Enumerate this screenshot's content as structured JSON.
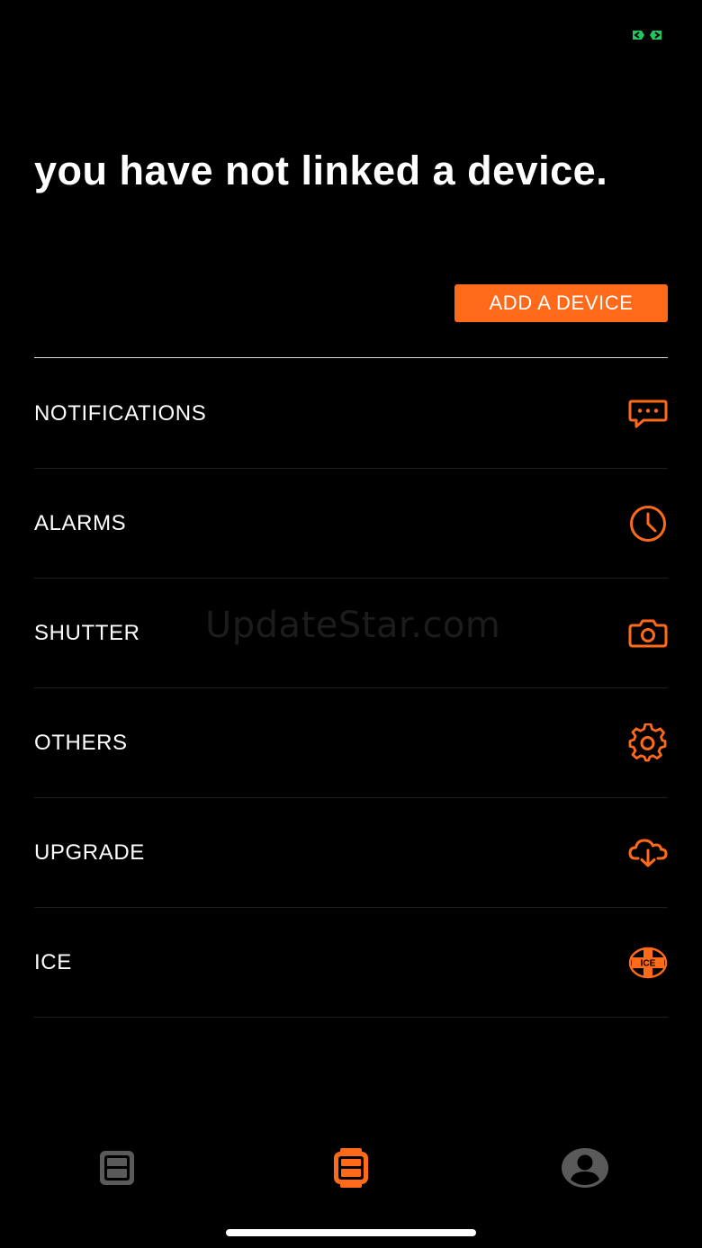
{
  "headline": "you have not linked a device.",
  "add_button_label": "ADD A DEVICE",
  "menu": {
    "items": [
      {
        "label": "NOTIFICATIONS",
        "icon": "chat-bubble-icon"
      },
      {
        "label": "ALARMS",
        "icon": "clock-icon"
      },
      {
        "label": "SHUTTER",
        "icon": "camera-icon"
      },
      {
        "label": "OTHERS",
        "icon": "gear-icon"
      },
      {
        "label": "UPGRADE",
        "icon": "cloud-download-icon"
      },
      {
        "label": "ICE",
        "icon": "ice-badge-icon",
        "badge_text": "ICE"
      }
    ]
  },
  "watermark": "UpdateStar.com",
  "tabs": [
    {
      "icon": "dashboard-icon",
      "active": false
    },
    {
      "icon": "device-icon",
      "active": true
    },
    {
      "icon": "profile-icon",
      "active": false
    }
  ],
  "colors": {
    "background": "#000000",
    "accent": "#FF6A1A",
    "text": "#FFFFFF",
    "inactive_tab": "#5A5A5A",
    "sync_indicator": "#22C55E"
  }
}
